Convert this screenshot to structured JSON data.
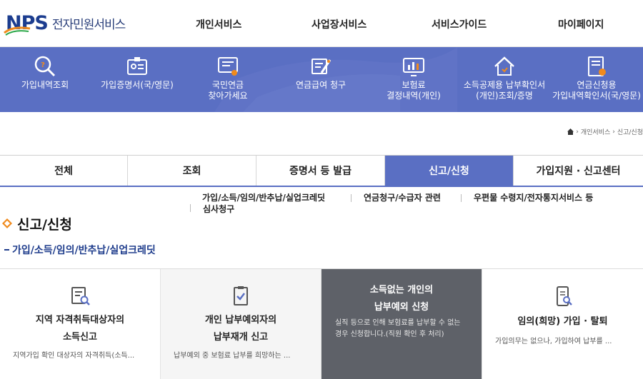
{
  "header": {
    "logo_text": "NPS",
    "logo_sub": "전자민원서비스",
    "nav": [
      "개인서비스",
      "사업장서비스",
      "서비스가이드",
      "마이페이지"
    ]
  },
  "quick": [
    {
      "label": "가입내역조회",
      "icon": "search-icon"
    },
    {
      "label": "가입증명서(국/영문)",
      "icon": "certificate-icon"
    },
    {
      "label": "국민연금\n찾아가세요",
      "icon": "monitor-doc-icon"
    },
    {
      "label": "연금급여 청구",
      "icon": "pen-doc-icon"
    },
    {
      "label": "보험료\n결정내역(개인)",
      "icon": "chart-monitor-icon"
    },
    {
      "label": "소득공제용 납부확인서\n(개인)조회/증명",
      "icon": "house-icon"
    },
    {
      "label": "연금신청용\n가입내역확인서(국/영문)",
      "icon": "doc-check-icon"
    }
  ],
  "breadcrumb": [
    "개인서비스",
    "신고/신청"
  ],
  "tabs": [
    "전체",
    "조회",
    "증명서 등 발급",
    "신고/신청",
    "가입지원 · 신고센터"
  ],
  "active_tab": "신고/신청",
  "sublinks": [
    "가입/소득/임의/반추납/실업크레딧",
    "연금청구/수급자 관련",
    "우편물 수령지/전자통지서비스 등",
    "심사청구"
  ],
  "page_title": "신고/신청",
  "section_title": "가입/소득/임의/반추납/실업크레딧",
  "cards": [
    {
      "title": "지역 자격취득대상자의\n소득신고",
      "desc": "지역가입 확인 대상자의 자격취득(소득...",
      "style": "plain-white",
      "icon": "doc-search-icon"
    },
    {
      "title": "개인 납부예외자의\n납부재개 신고",
      "desc": "납부예외 중 보험료 납부를 희망하는 ...",
      "style": "gray",
      "icon": "doc-check-icon"
    },
    {
      "title": "소득없는 개인의\n납부예외 신청",
      "desc": "실직 등으로 인해 보험료를 납부할 수 없는\n경우 신청합니다.(직원 확인 후 처리)",
      "style": "dark",
      "icon": ""
    },
    {
      "title": "임의(희망) 가입 · 탈퇴",
      "desc": "가입의무는 없으나, 가입하여 납부를 ...",
      "style": "plain",
      "icon": "phone-search-icon"
    }
  ],
  "colors": {
    "brand": "#5a6fc3",
    "dark_card": "#5e6168",
    "orange": "#f08a1c",
    "navy": "#1c3d8f"
  }
}
